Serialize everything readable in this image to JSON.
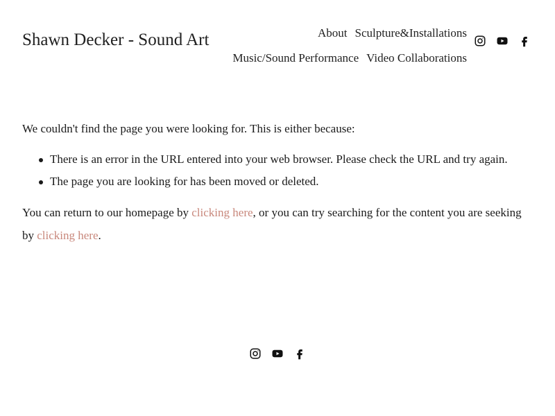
{
  "site": {
    "title": "Shawn Decker - Sound Art"
  },
  "nav": {
    "items": [
      {
        "label": "About"
      },
      {
        "label": "Sculpture&Installations"
      },
      {
        "label": "Music/Sound Performance"
      },
      {
        "label": "Video Collaborations"
      }
    ]
  },
  "social": {
    "icons": [
      "instagram-icon",
      "youtube-icon",
      "facebook-icon"
    ]
  },
  "main": {
    "intro": "We couldn't find the page you were looking for. This is either because:",
    "reasons": [
      "There is an error in the URL entered into your web browser. Please check the URL and try again.",
      "The page you are looking for has been moved or deleted."
    ],
    "return_prefix": "You can return to our homepage by ",
    "link1": "clicking here",
    "return_middle": ", or you can try searching for the content you are seeking by ",
    "link2": "clicking here",
    "return_suffix": "."
  },
  "colors": {
    "link": "#c8877b",
    "text": "#1a1a1a"
  }
}
